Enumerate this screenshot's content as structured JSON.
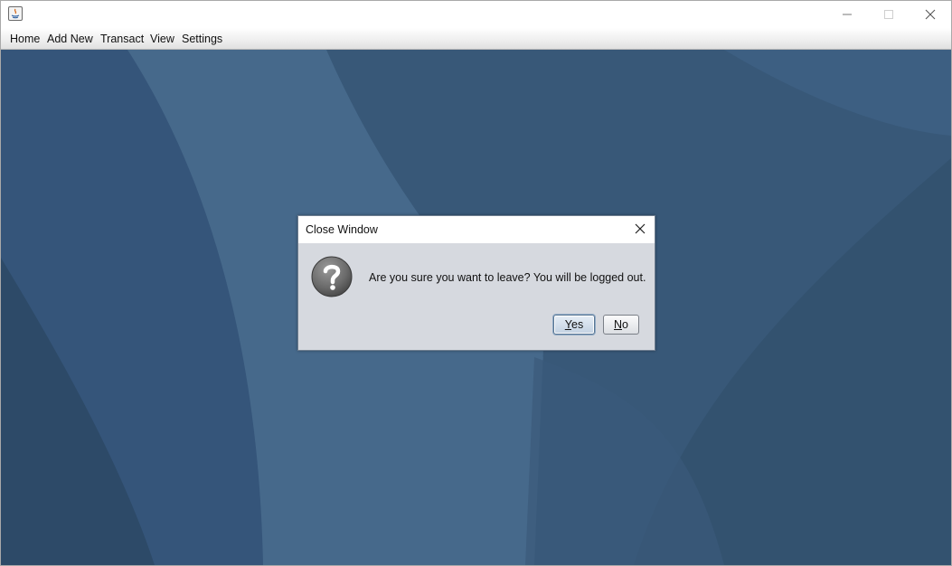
{
  "window": {
    "title": "",
    "controls": [
      "minimize-icon",
      "maximize-icon",
      "close-icon"
    ]
  },
  "menubar": {
    "items": [
      "Home",
      "Add New",
      "Transact",
      "View",
      "Settings"
    ]
  },
  "dialog": {
    "title": "Close Window",
    "icon": "question-icon",
    "message": "Are you sure you want to leave? You will be logged out.",
    "buttons": {
      "yes": {
        "mnemonic": "Y",
        "rest": "es"
      },
      "no": {
        "mnemonic": "N",
        "rest": "o"
      }
    }
  },
  "colors": {
    "desktop": "#3b5c7c",
    "dialog_bg": "#d6d9df",
    "default_button_border": "#5b7895"
  }
}
